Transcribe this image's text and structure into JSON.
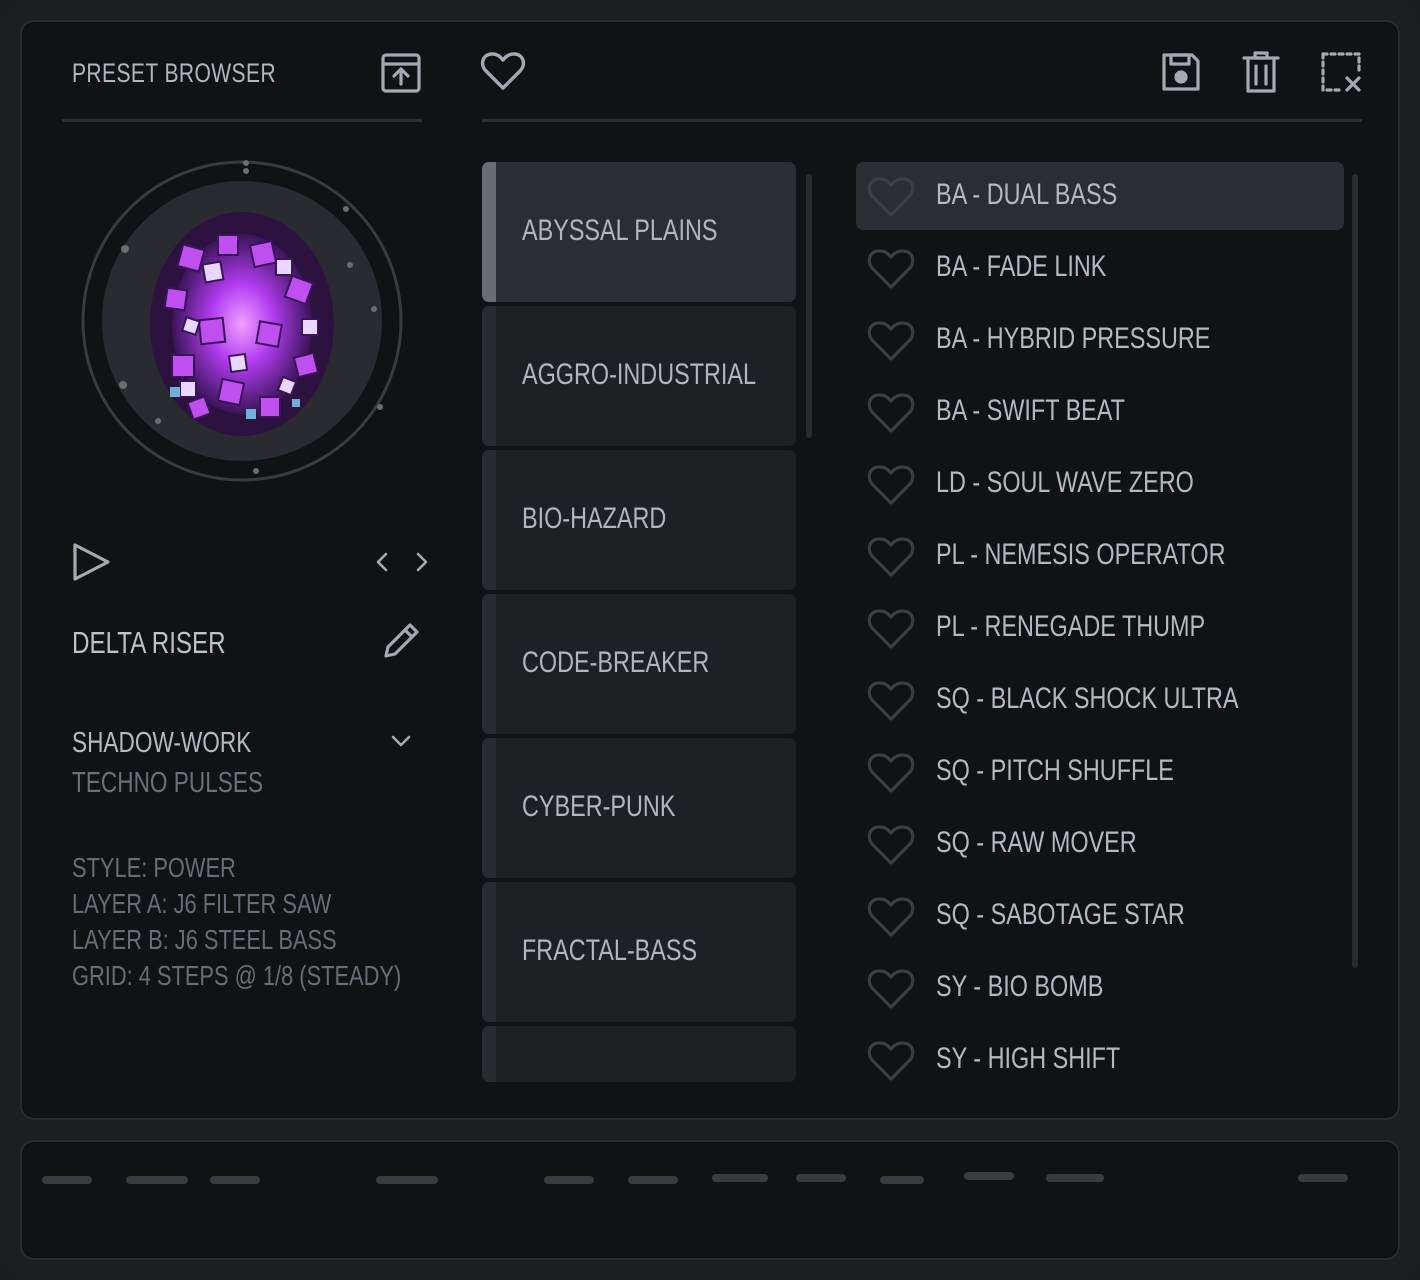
{
  "header": {
    "title": "PRESET BROWSER"
  },
  "toolbar": {
    "icons": [
      "import-icon",
      "heart-icon",
      "save-icon",
      "trash-icon",
      "deselect-icon"
    ]
  },
  "current_preset": {
    "name": "DELTA RISER",
    "category": "SHADOW-WORK",
    "subcategory": "TECHNO PULSES",
    "details": [
      "STYLE: POWER",
      "LAYER A: J6 FILTER SAW",
      "LAYER B: J6 STEEL BASS",
      "GRID: 4 STEPS @ 1/8 (STEADY)"
    ]
  },
  "banks": [
    {
      "label": "ABYSSAL PLAINS",
      "active": true
    },
    {
      "label": "AGGRO-INDUSTRIAL",
      "active": false
    },
    {
      "label": "BIO-HAZARD",
      "active": false
    },
    {
      "label": "CODE-BREAKER",
      "active": false
    },
    {
      "label": "CYBER-PUNK",
      "active": false
    },
    {
      "label": "FRACTAL-BASS",
      "active": false
    },
    {
      "label": "",
      "active": false
    }
  ],
  "presets": [
    {
      "label": "BA - DUAL BASS",
      "active": true
    },
    {
      "label": "BA - FADE LINK",
      "active": false
    },
    {
      "label": "BA - HYBRID PRESSURE",
      "active": false
    },
    {
      "label": "BA - SWIFT BEAT",
      "active": false
    },
    {
      "label": "LD - SOUL WAVE ZERO",
      "active": false
    },
    {
      "label": "PL - NEMESIS OPERATOR",
      "active": false
    },
    {
      "label": "PL - RENEGADE THUMP",
      "active": false
    },
    {
      "label": "SQ - BLACK SHOCK ULTRA",
      "active": false
    },
    {
      "label": "SQ - PITCH SHUFFLE",
      "active": false
    },
    {
      "label": "SQ - RAW MOVER",
      "active": false
    },
    {
      "label": "SQ - SABOTAGE STAR",
      "active": false
    },
    {
      "label": "SY - BIO BOMB",
      "active": false
    },
    {
      "label": "SY - HIGH SHIFT",
      "active": false
    }
  ],
  "colors": {
    "background": "#111214",
    "panel_active": "#2c2d33",
    "text": "#b7b8c0",
    "text_muted": "#6a6b74",
    "accent_purple": "#b13cf0"
  }
}
